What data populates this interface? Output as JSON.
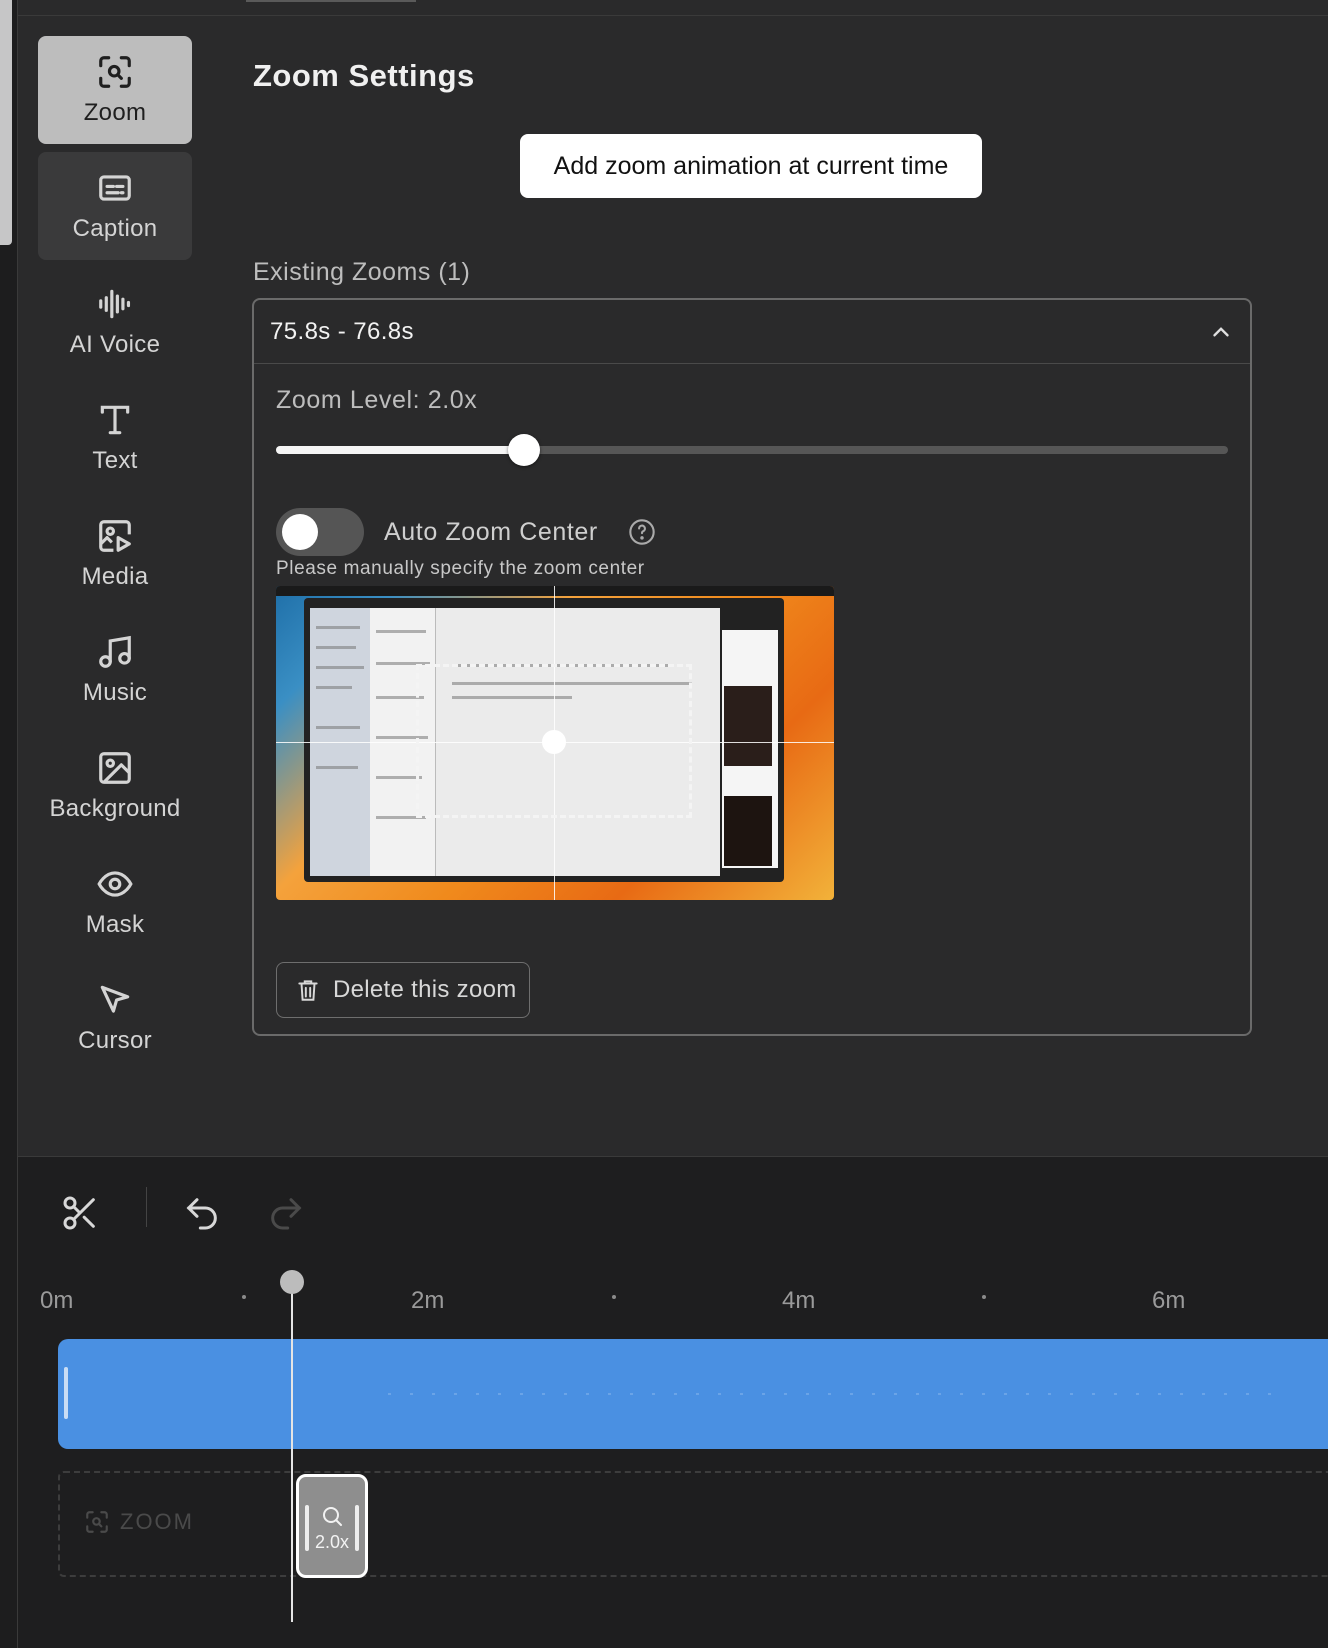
{
  "sidebar": {
    "items": [
      {
        "label": "Zoom",
        "icon": "zoom-icon",
        "state": "active"
      },
      {
        "label": "Caption",
        "icon": "caption-icon",
        "state": "hover"
      },
      {
        "label": "AI Voice",
        "icon": "waveform-icon"
      },
      {
        "label": "Text",
        "icon": "text-icon"
      },
      {
        "label": "Media",
        "icon": "media-icon"
      },
      {
        "label": "Music",
        "icon": "music-icon"
      },
      {
        "label": "Background",
        "icon": "image-icon"
      },
      {
        "label": "Mask",
        "icon": "eye-icon"
      },
      {
        "label": "Cursor",
        "icon": "cursor-icon"
      }
    ]
  },
  "panel": {
    "title": "Zoom Settings",
    "add_button": "Add zoom animation at current time",
    "existing_label": "Existing Zooms (1)"
  },
  "zoom_item": {
    "range": "75.8s - 76.8s",
    "zoom_level_label": "Zoom Level: 2.0x",
    "zoom_level_fraction": 0.26,
    "auto_center_label": "Auto Zoom Center",
    "auto_center_enabled": false,
    "manual_hint": "Please manually specify the zoom center",
    "delete_label": "Delete this zoom"
  },
  "timeline": {
    "ruler": [
      "0m",
      "2m",
      "4m",
      "6m"
    ],
    "zoom_track_label": "ZOOM",
    "zoom_clip_label": "2.0x",
    "track_color": "#4a90e2"
  },
  "colors": {
    "accent": "#4a90e2",
    "active_tab": "#bdbdbd",
    "background": "#2a2a2b"
  }
}
